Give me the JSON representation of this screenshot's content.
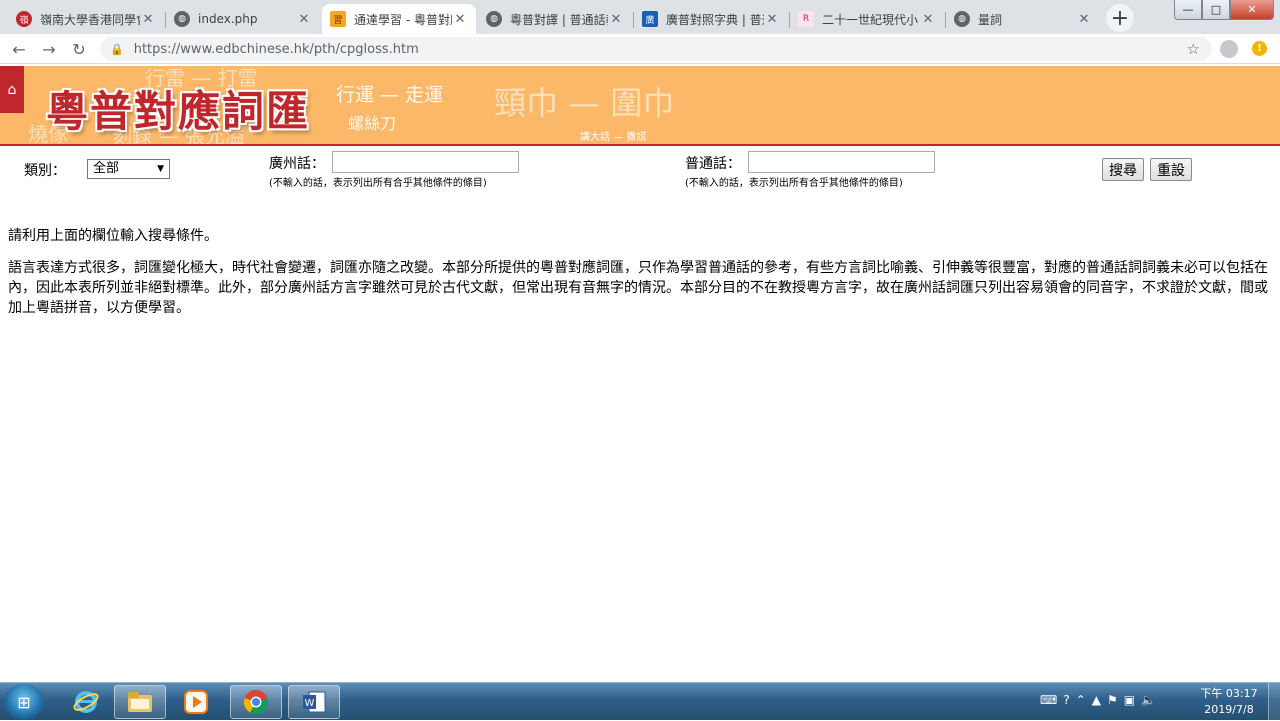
{
  "browser": {
    "tabs": [
      {
        "title": "嶺南大學香港同學會",
        "favicon": "lingnan-logo-icon",
        "active": false
      },
      {
        "title": "index.php",
        "favicon": "globe-icon",
        "active": false
      },
      {
        "title": "通達學習 - 粵普對應",
        "favicon": "edb-logo-icon",
        "active": true
      },
      {
        "title": "粵普對譯 | 普通話教",
        "favicon": "globe-icon",
        "active": false
      },
      {
        "title": "廣普對照字典 | 普通",
        "favicon": "dict-logo-icon",
        "active": false
      },
      {
        "title": "二十一世紀現代小",
        "favicon": "book-logo-icon",
        "active": false
      },
      {
        "title": "量詞",
        "favicon": "globe-icon",
        "active": false
      }
    ],
    "url": "https://www.edbchinese.hk/pth/cpgloss.htm",
    "window_buttons": {
      "minimize": "—",
      "maximize": "□",
      "close": "✕"
    }
  },
  "banner": {
    "title": "粵普對應詞匯",
    "ghost_words": [
      "行雷 — 打雷",
      "燒傢",
      "刻錄 — 張允溢",
      "行運 — 走運",
      "螺絲刀",
      "頸巾 — 圍巾",
      "講大話 — 撒謊"
    ]
  },
  "form": {
    "category_label": "類別：",
    "category_value": "全部",
    "cantonese_label": "廣州話：",
    "cantonese_hint": "(不輸入的話，表示列出所有合乎其他條件的條目)",
    "mandarin_label": "普通話：",
    "mandarin_hint": "(不輸入的話，表示列出所有合乎其他條件的條目)",
    "search_button": "搜尋",
    "reset_button": "重設"
  },
  "content": {
    "prompt": "請利用上面的欄位輸入搜尋條件。",
    "description": "語言表達方式很多，詞匯變化極大，時代社會變遷，詞匯亦隨之改變。本部分所提供的粵普對應詞匯，只作為學習普通話的參考，有些方言詞比喻義、引伸義等很豐富，對應的普通話詞詞義未必可以包括在內，因此本表所列並非絕對標準。此外，部分廣州話方言字雖然可見於古代文獻，但常出現有音無字的情況。本部分目的不在教授粵方言字，故在廣州話詞匯只列出容易領會的同音字，不求證於文獻，間或加上粵語拼音，以方便學習。"
  },
  "taskbar": {
    "apps": [
      "internet-explorer-icon",
      "file-explorer-icon",
      "media-player-icon",
      "chrome-icon",
      "word-icon"
    ],
    "tray_icons": [
      "keyboard-icon",
      "help-icon",
      "language-icon",
      "show-hidden-icon",
      "flag-icon",
      "network-icon",
      "volume-icon"
    ],
    "time": "下午 03:17",
    "date": "2019/7/8"
  },
  "colors": {
    "banner_bg": "#fbb868",
    "brand_red": "#c0272d"
  }
}
